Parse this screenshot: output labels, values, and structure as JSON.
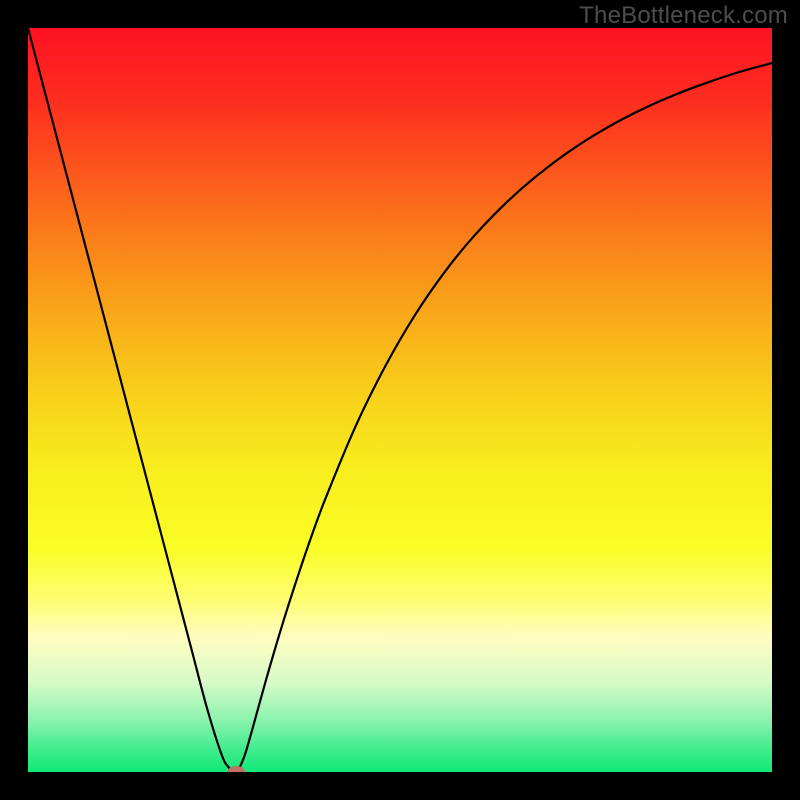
{
  "watermark": "TheBottleneck.com",
  "chart_data": {
    "type": "line",
    "title": "",
    "xlabel": "",
    "ylabel": "",
    "xlim": [
      0,
      100
    ],
    "ylim": [
      0,
      100
    ],
    "background_gradient_stops": [
      {
        "offset": 0.0,
        "color": "#fe1223"
      },
      {
        "offset": 0.1,
        "color": "#fd2e1f"
      },
      {
        "offset": 0.2,
        "color": "#fc5a1c"
      },
      {
        "offset": 0.3,
        "color": "#fa861a"
      },
      {
        "offset": 0.4,
        "color": "#f9ae19"
      },
      {
        "offset": 0.5,
        "color": "#f8d31a"
      },
      {
        "offset": 0.6,
        "color": "#f8ef1e"
      },
      {
        "offset": 0.7,
        "color": "#fafd26"
      },
      {
        "offset": 0.77,
        "color": "#fffd75"
      },
      {
        "offset": 0.82,
        "color": "#fffdc1"
      },
      {
        "offset": 0.88,
        "color": "#d6fac7"
      },
      {
        "offset": 0.93,
        "color": "#8cf3af"
      },
      {
        "offset": 0.97,
        "color": "#3fec8d"
      },
      {
        "offset": 1.0,
        "color": "#11e877"
      }
    ],
    "series": [
      {
        "name": "bottleneck-curve",
        "x": [
          0,
          2,
          4,
          6,
          8,
          10,
          12,
          14,
          16,
          18,
          20,
          22,
          24,
          26,
          27,
          28,
          29,
          30,
          32,
          34,
          36,
          38,
          40,
          44,
          48,
          52,
          56,
          60,
          65,
          70,
          75,
          80,
          85,
          90,
          95,
          100
        ],
        "values": [
          100,
          92.4,
          84.8,
          77.2,
          69.6,
          62.0,
          54.4,
          46.8,
          39.2,
          31.6,
          24.0,
          16.4,
          8.8,
          2.4,
          0.6,
          0.0,
          1.9,
          5.2,
          12.4,
          19.2,
          25.5,
          31.4,
          36.8,
          46.4,
          54.5,
          61.4,
          67.2,
          72.1,
          77.2,
          81.4,
          84.9,
          87.8,
          90.2,
          92.2,
          93.9,
          95.3
        ]
      }
    ],
    "marker": {
      "x": 28.0,
      "y": 0.0,
      "color": "#bf7267",
      "rx": 1.2,
      "ry": 0.8
    }
  }
}
